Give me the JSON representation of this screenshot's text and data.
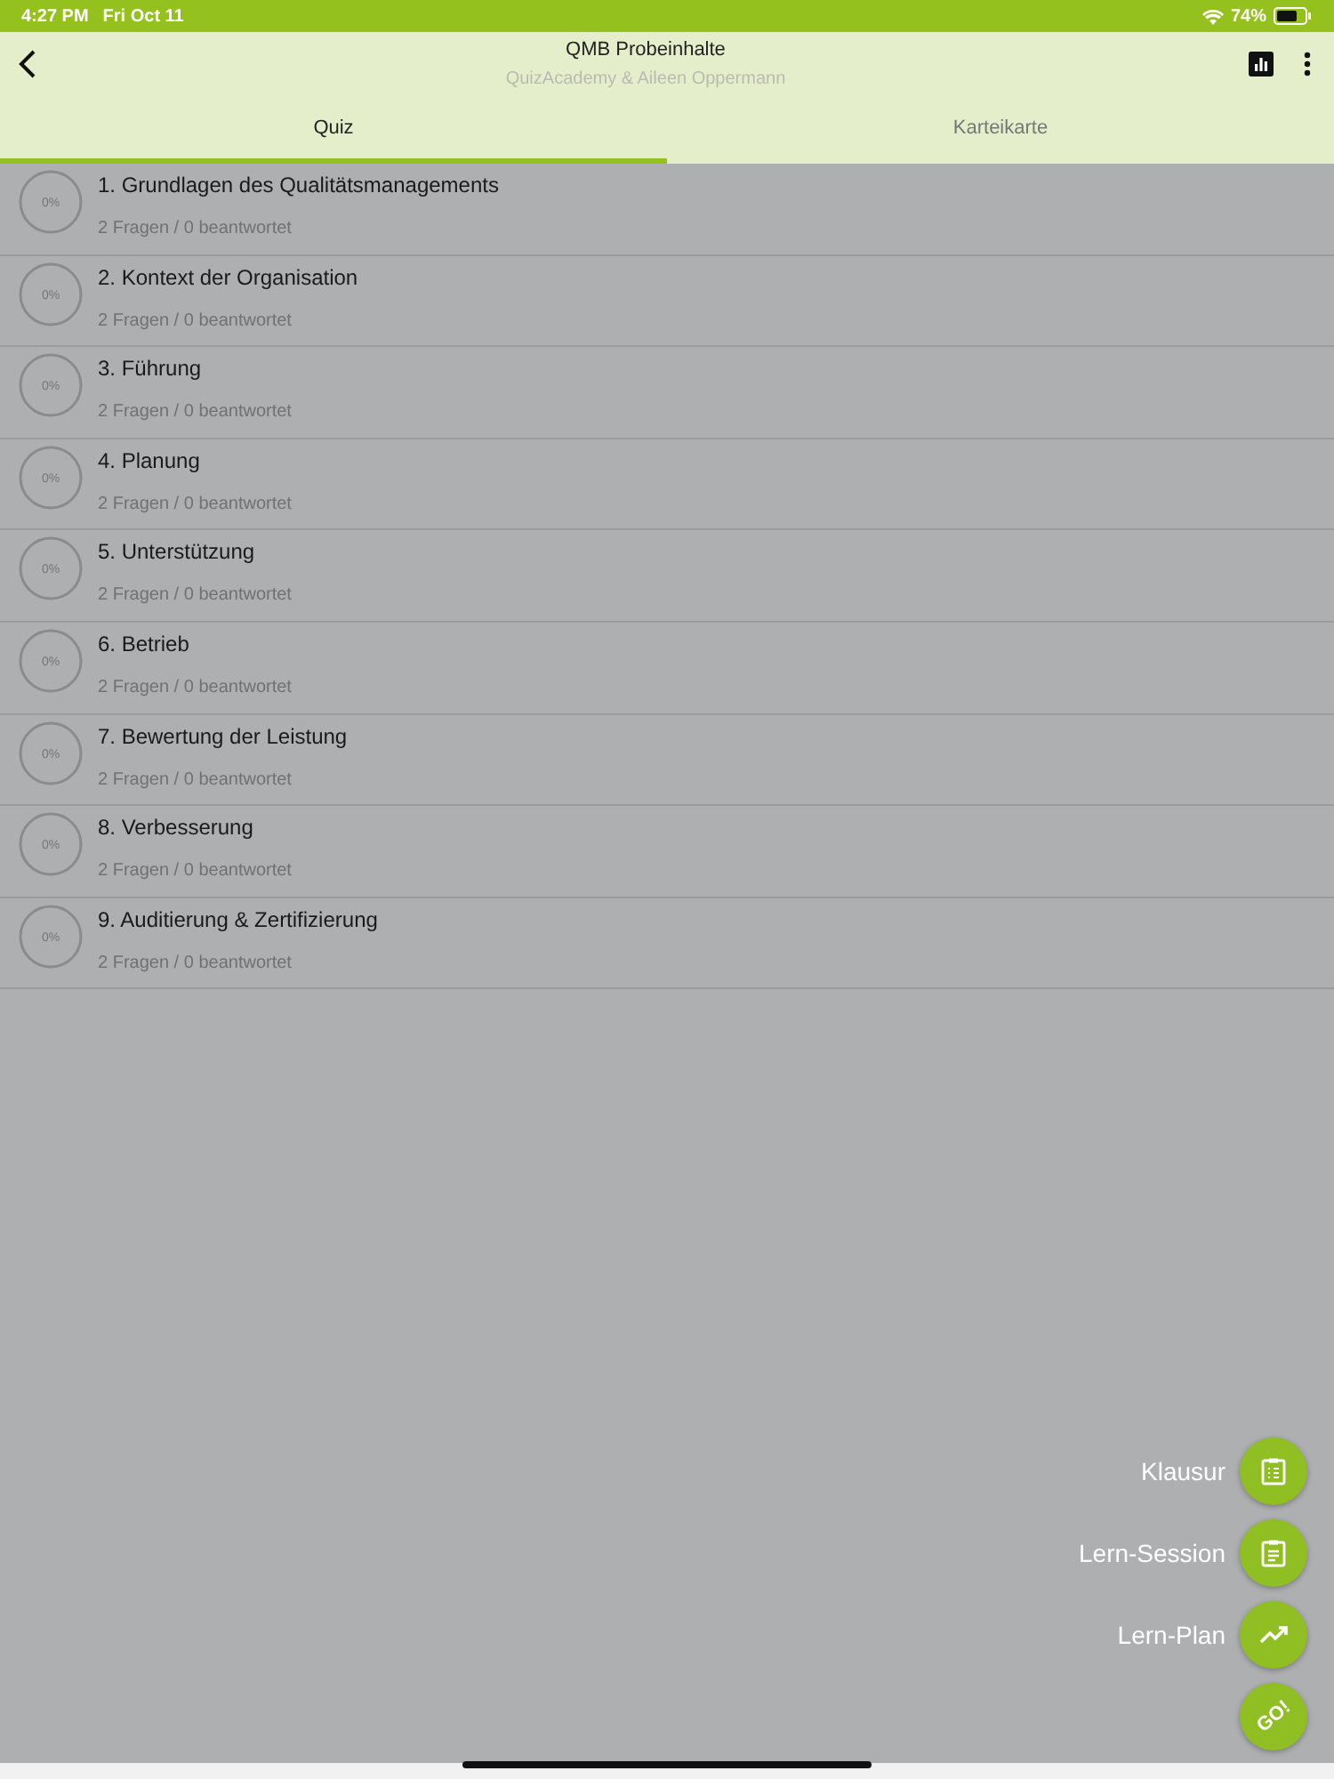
{
  "status_bar": {
    "time": "4:27 PM",
    "date": "Fri Oct 11",
    "battery": "74%"
  },
  "header": {
    "title": "QMB Probeinhalte",
    "subtitle": "QuizAcademy & Aileen Oppermann"
  },
  "tabs": [
    {
      "label": "Quiz",
      "selected": true
    },
    {
      "label": "Karteikarte",
      "selected": false
    }
  ],
  "chapters": [
    {
      "title": "1. Grundlagen des Qualitätsmanagements",
      "progress": "0%",
      "level": 0,
      "info": "2 Fragen / 0 beantwortet"
    },
    {
      "title": "2. Kontext der Organisation",
      "progress": "0%",
      "level": 0,
      "info": "2 Fragen / 0 beantwortet"
    },
    {
      "title": "3. Führung",
      "progress": "0%",
      "level": 0,
      "info": "2 Fragen / 0 beantwortet"
    },
    {
      "title": "4. Planung",
      "progress": "0%",
      "level": 0,
      "info": "2 Fragen / 0 beantwortet"
    },
    {
      "title": "5. Unterstützung",
      "progress": "0%",
      "level": 0,
      "info": "2 Fragen / 0 beantwortet"
    },
    {
      "title": "6. Betrieb",
      "progress": "0%",
      "level": 0,
      "info": "2 Fragen / 0 beantwortet"
    },
    {
      "title": "7. Bewertung der Leistung",
      "progress": "0%",
      "level": 0,
      "info": "2 Fragen / 0 beantwortet"
    },
    {
      "title": "8. Verbesserung",
      "progress": "0%",
      "level": 0,
      "info": "2 Fragen / 0 beantwortet"
    },
    {
      "title": "9. Auditierung & Zertifizierung",
      "progress": "0%",
      "level": 0,
      "info": "2 Fragen / 0 beantwortet"
    }
  ],
  "actions": [
    {
      "label": "Klausur",
      "kind": "exam"
    },
    {
      "label": "Lern-Session",
      "kind": "session"
    },
    {
      "label": "Lern-Plan",
      "kind": "plan"
    }
  ],
  "go_button": "GO!"
}
